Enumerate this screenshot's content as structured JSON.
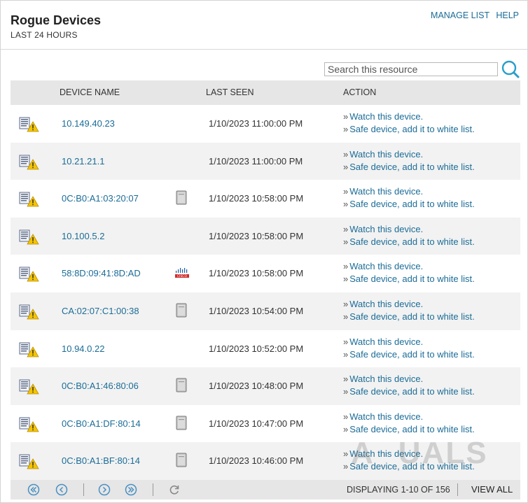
{
  "header": {
    "title": "Rogue Devices",
    "subtitle": "LAST 24 HOURS",
    "manage_list": "MANAGE LIST",
    "help": "HELP"
  },
  "search": {
    "placeholder": "Search this resource",
    "value": ""
  },
  "columns": {
    "device_name": "DEVICE NAME",
    "last_seen": "LAST SEEN",
    "action": "ACTION"
  },
  "action_labels": {
    "watch": "Watch this device.",
    "safe": "Safe device, add it to white list.",
    "arrow": "»"
  },
  "rows": [
    {
      "name": "10.149.40.23",
      "vendor": "none",
      "last_seen": "1/10/2023 11:00:00 PM"
    },
    {
      "name": "10.21.21.1",
      "vendor": "none",
      "last_seen": "1/10/2023 11:00:00 PM"
    },
    {
      "name": "0C:B0:A1:03:20:07",
      "vendor": "generic",
      "last_seen": "1/10/2023 10:58:00 PM"
    },
    {
      "name": "10.100.5.2",
      "vendor": "none",
      "last_seen": "1/10/2023 10:58:00 PM"
    },
    {
      "name": "58:8D:09:41:8D:AD",
      "vendor": "cisco",
      "last_seen": "1/10/2023 10:58:00 PM"
    },
    {
      "name": "CA:02:07:C1:00:38",
      "vendor": "generic",
      "last_seen": "1/10/2023 10:54:00 PM"
    },
    {
      "name": "10.94.0.22",
      "vendor": "none",
      "last_seen": "1/10/2023 10:52:00 PM"
    },
    {
      "name": "0C:B0:A1:46:80:06",
      "vendor": "generic",
      "last_seen": "1/10/2023 10:48:00 PM"
    },
    {
      "name": "0C:B0:A1:DF:80:14",
      "vendor": "generic",
      "last_seen": "1/10/2023 10:47:00 PM"
    },
    {
      "name": "0C:B0:A1:BF:80:14",
      "vendor": "generic",
      "last_seen": "1/10/2023 10:46:00 PM"
    }
  ],
  "footer": {
    "displaying": "DISPLAYING 1-10 OF 156",
    "view_all": "VIEW ALL",
    "icons": [
      "first-page-icon",
      "prev-page-icon",
      "next-page-icon",
      "last-page-icon",
      "refresh-icon"
    ]
  },
  "watermark": "APPUALS",
  "colors": {
    "link": "#1b6c97",
    "header_bg": "#e6e6e6",
    "alt_row": "#f2f2f2",
    "warning": "#f5c400",
    "search_icon": "#2a9fc9"
  }
}
